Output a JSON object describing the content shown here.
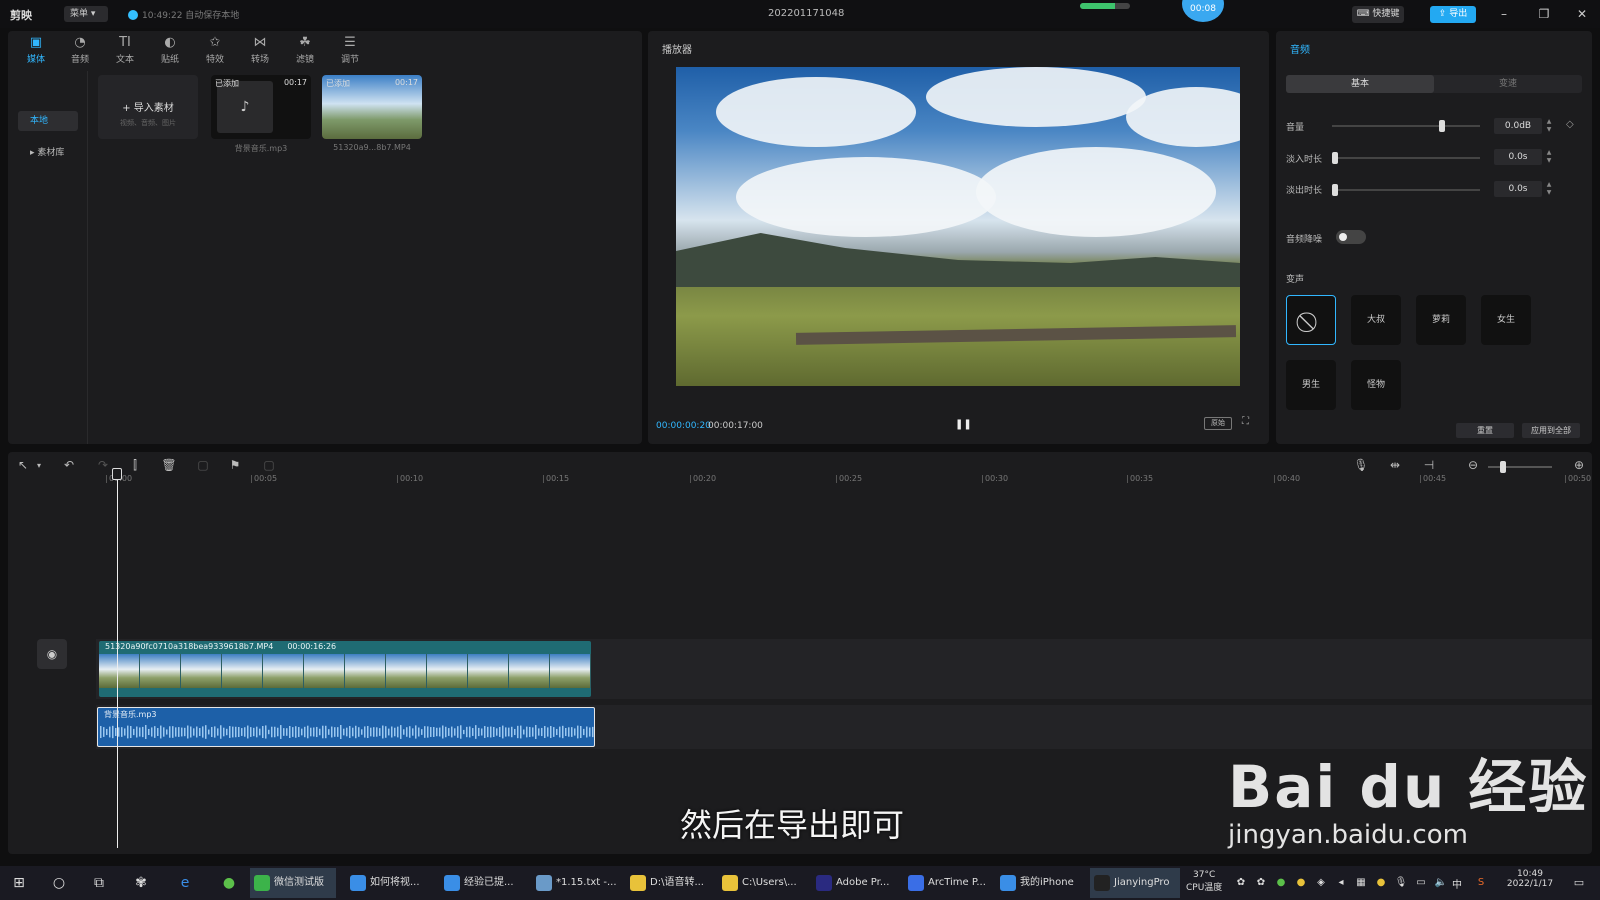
{
  "app": {
    "logo": "剪映",
    "menu_label": "菜单",
    "autosave": "10:49:22 自动保存本地",
    "project_title": "202201171048",
    "progress_fraction": 0.7,
    "timer": "00:08",
    "shortcut_label": "快捷键",
    "export_label": "导出"
  },
  "media": {
    "tabs": [
      {
        "label": "媒体",
        "icon": "media-icon"
      },
      {
        "label": "音频",
        "icon": "audio-icon"
      },
      {
        "label": "文本",
        "icon": "text-icon"
      },
      {
        "label": "贴纸",
        "icon": "sticker-icon"
      },
      {
        "label": "特效",
        "icon": "effects-icon"
      },
      {
        "label": "转场",
        "icon": "transition-icon"
      },
      {
        "label": "滤镜",
        "icon": "filter-icon"
      },
      {
        "label": "调节",
        "icon": "adjust-icon"
      }
    ],
    "sidebar": [
      "本地",
      "素材库"
    ],
    "import_label": "导入素材",
    "import_hint": "视频、音频、图片",
    "items": [
      {
        "tag": "已添加",
        "duration": "00:17",
        "name": "背景音乐.mp3"
      },
      {
        "tag": "已添加",
        "duration": "00:17",
        "name": "51320a9...8b7.MP4"
      }
    ]
  },
  "player": {
    "title": "播放器",
    "current_time": "00:00:00:20",
    "total_time": "00:00:17:00",
    "ratio_label": "原始"
  },
  "props": {
    "title": "音频",
    "tabs": [
      "基本",
      "变速"
    ],
    "volume_label": "音量",
    "volume_value": "0.0dB",
    "volume_fraction": 0.75,
    "fadein_label": "淡入时长",
    "fadein_value": "0.0s",
    "fadeout_label": "淡出时长",
    "fadeout_value": "0.0s",
    "denoise_label": "音频降噪",
    "voice_label": "变声",
    "voices": [
      "大叔",
      "萝莉",
      "女生",
      "男生",
      "怪物"
    ],
    "reset_label": "重置",
    "apply_all_label": "应用到全部"
  },
  "timeline": {
    "ruler": [
      "00:00",
      "00:05",
      "00:10",
      "00:15",
      "00:20",
      "00:25",
      "00:30",
      "00:35",
      "00:40",
      "00:45",
      "00:50"
    ],
    "video_clip": {
      "name": "51320a90fc0710a318bea9339618b7.MP4",
      "duration": "00:00:16:26"
    },
    "audio_clip": {
      "name": "背景音乐.mp3"
    },
    "subtitle": "然后在导出即可"
  },
  "watermark": {
    "line1": "Bai du 经验",
    "line2": "jingyan.baidu.com"
  },
  "taskbar": {
    "apps": [
      "微信测试版",
      "如何将视...",
      "经验已提...",
      "*1.15.txt -...",
      "D:\\语音转...",
      "C:\\Users\\...",
      "Adobe Pr...",
      "ArcTime P...",
      "我的iPhone",
      "JianyingPro"
    ],
    "temp": "37°C",
    "temp_label": "CPU温度",
    "ime": "中",
    "time": "10:49",
    "date": "2022/1/17"
  }
}
